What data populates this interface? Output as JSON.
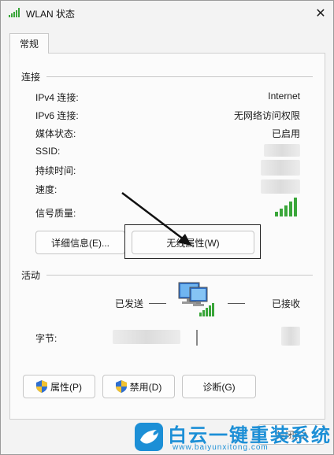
{
  "window": {
    "title": "WLAN 状态",
    "close_glyph": "✕"
  },
  "tab": {
    "label": "常规"
  },
  "connection": {
    "section_label": "连接",
    "rows": [
      {
        "label": "IPv4 连接:",
        "value": "Internet"
      },
      {
        "label": "IPv6 连接:",
        "value": "无网络访问权限"
      },
      {
        "label": "媒体状态:",
        "value": "已启用"
      },
      {
        "label": "SSID:",
        "value": ""
      },
      {
        "label": "持续时间:",
        "value": ""
      },
      {
        "label": "速度:",
        "value": ""
      },
      {
        "label": "信号质量:",
        "value": ""
      }
    ],
    "details_button": "详细信息(E)...",
    "wireless_props_button": "无线属性(W)"
  },
  "activity": {
    "section_label": "活动",
    "sent_label": "已发送",
    "received_label": "已接收",
    "bytes_label": "字节:"
  },
  "buttons": {
    "properties": "属性(P)",
    "disable": "禁用(D)",
    "diagnose": "诊断(G)",
    "close": "关闭(C)"
  },
  "watermark": {
    "text": "白云一键重装系统",
    "url": "www.baiyunxitong.com"
  },
  "colors": {
    "signal_green": "#3aa63a",
    "brand_blue": "#1c8fd6",
    "shield_blue": "#2f6fd0",
    "shield_yellow": "#f2c230"
  }
}
